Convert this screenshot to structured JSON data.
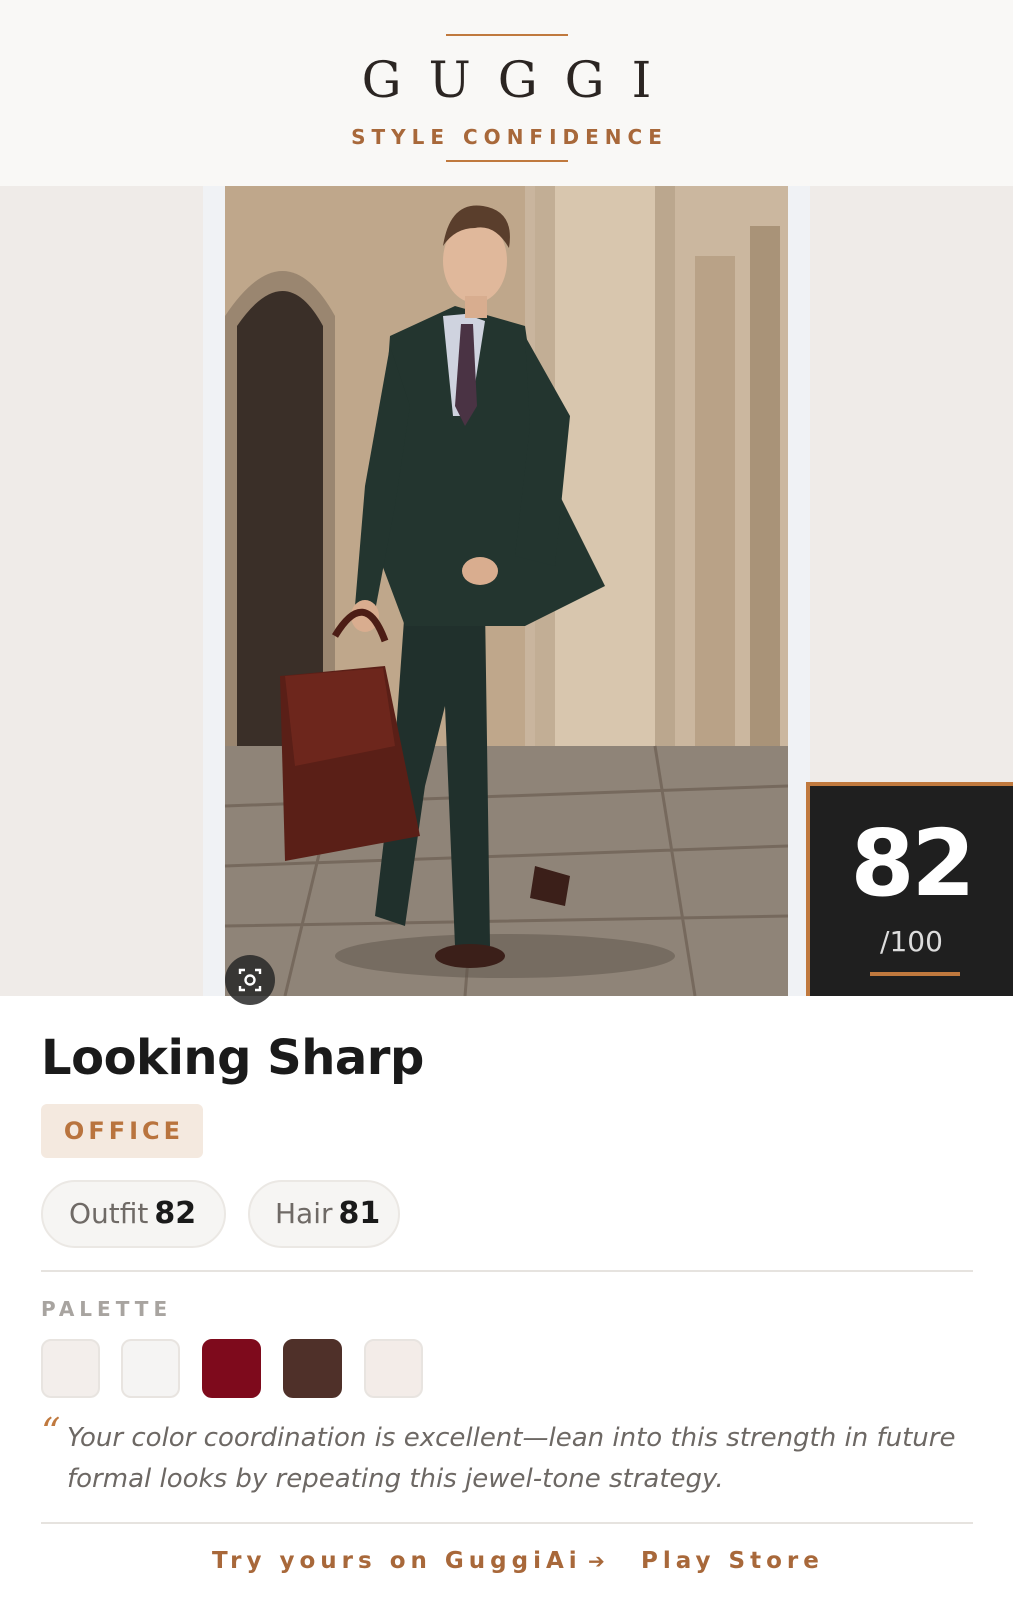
{
  "header": {
    "brand": "GUGGI",
    "tagline": "STYLE CONFIDENCE"
  },
  "score": {
    "value": "82",
    "max": "/100"
  },
  "result": {
    "title": "Looking Sharp",
    "occasion_tag": "OFFICE"
  },
  "subscores": [
    {
      "label": "Outfit",
      "value": "82"
    },
    {
      "label": "Hair",
      "value": "81"
    }
  ],
  "palette": {
    "label": "PALETTE",
    "colors": [
      "#f3eeeb",
      "#f5f4f3",
      "#7e0a1c",
      "#4f3029",
      "#f3ece8"
    ]
  },
  "feedback": {
    "quote": "Your color coordination is excellent—lean into this strength in future formal looks by repeating this jewel-tone strategy."
  },
  "footer": {
    "cta": "Try yours on GuggiAi",
    "arrow": "➔",
    "store": "Play Store"
  },
  "icons": {
    "lens": "visual-search-icon"
  },
  "colors": {
    "accent": "#c0793e",
    "score_card_bg": "#1f1f1f"
  }
}
